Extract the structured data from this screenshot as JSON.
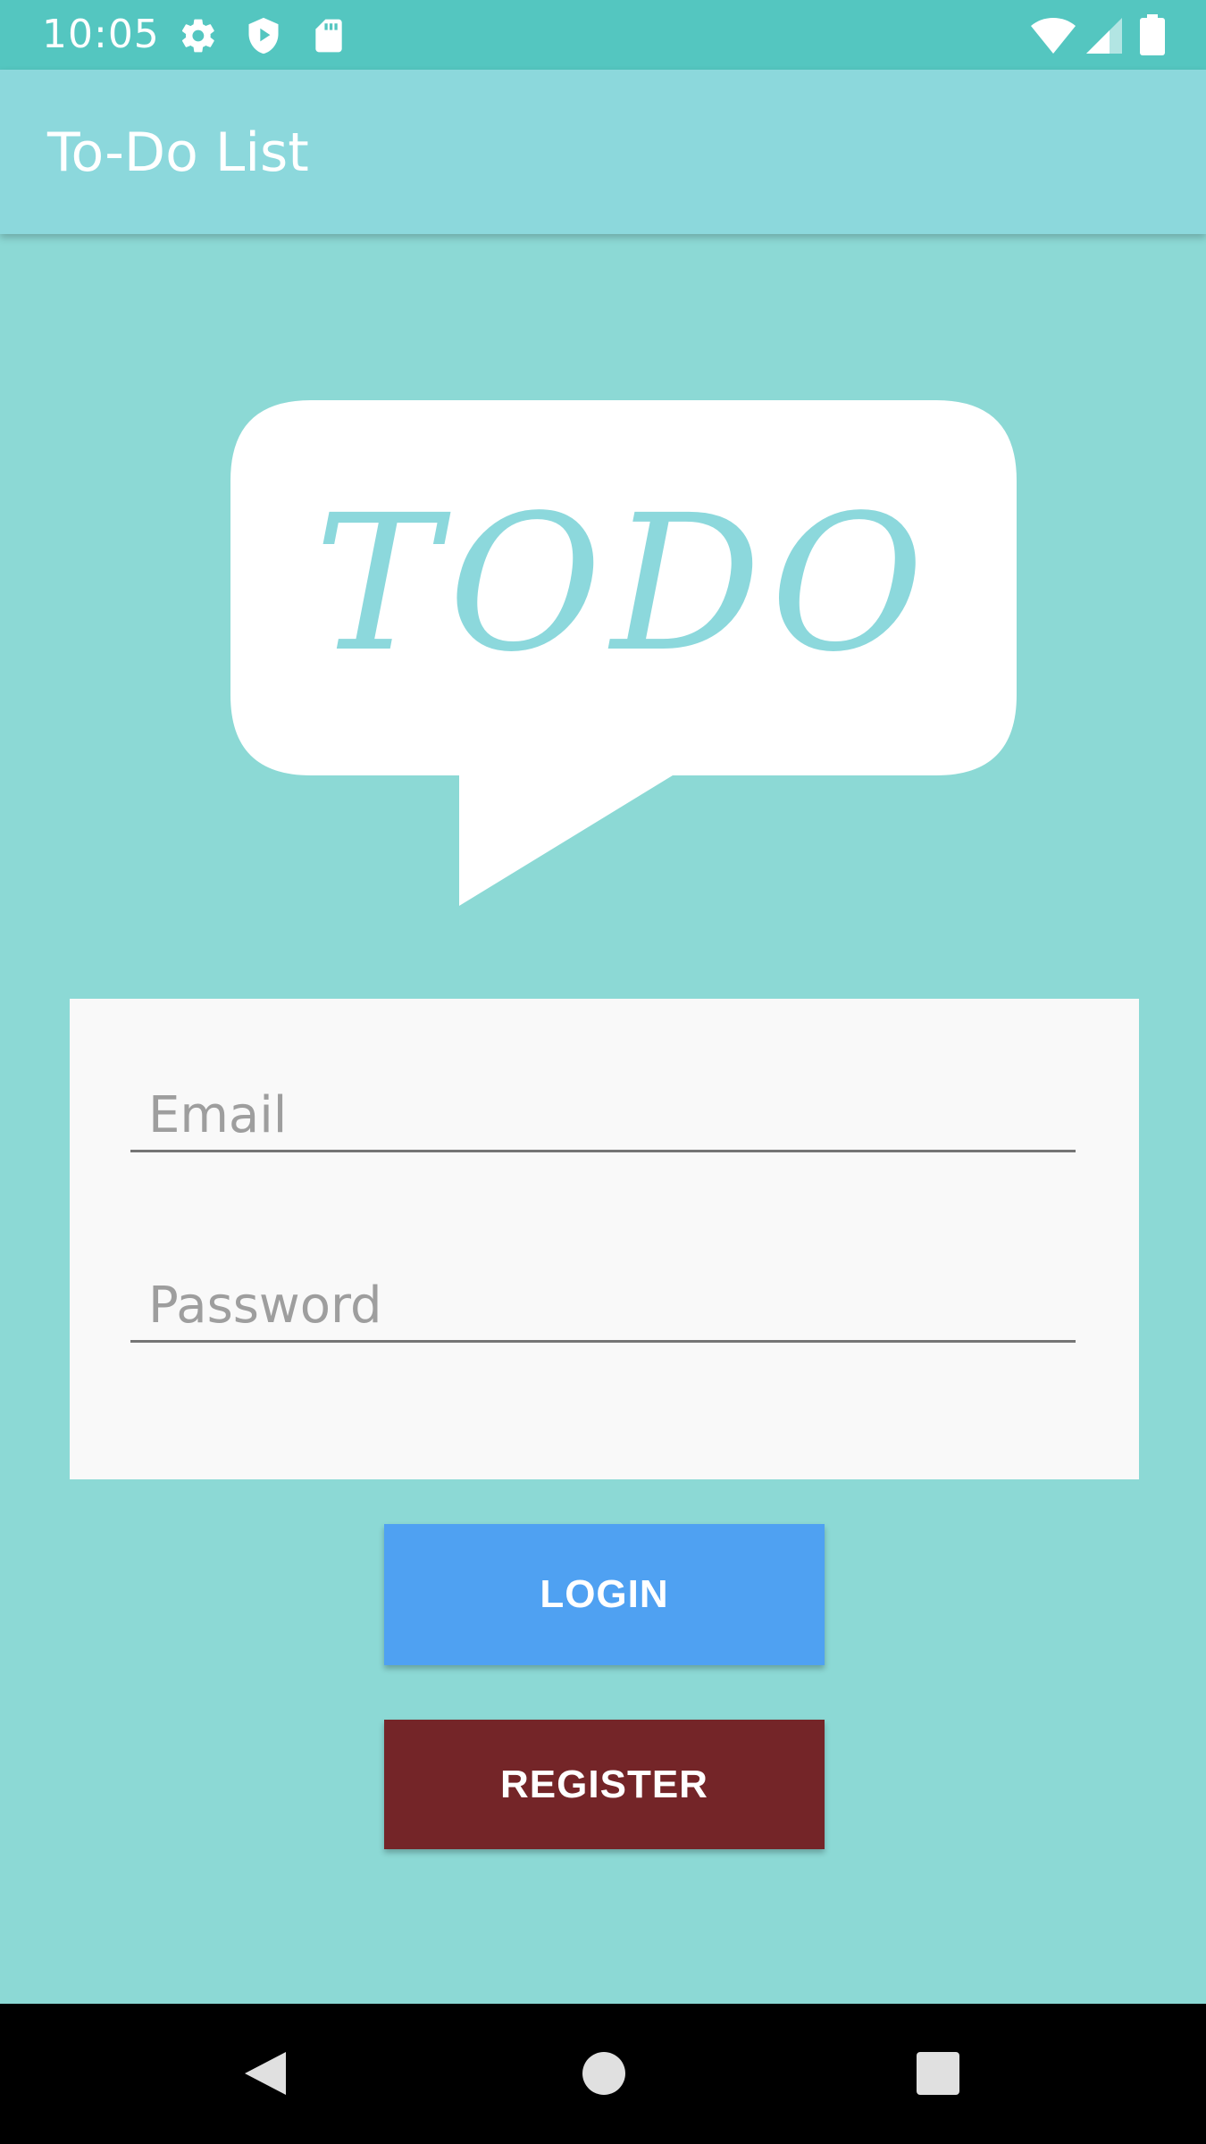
{
  "status_bar": {
    "time": "10:05",
    "left_icons": [
      "gear-icon",
      "shield-play-icon",
      "sd-card-icon"
    ],
    "right_icons": [
      "wifi-icon",
      "cell-signal-icon",
      "battery-icon"
    ],
    "color": "#54c6c0"
  },
  "app_bar": {
    "title": "To-Do List",
    "color": "#8cd8dc"
  },
  "logo": {
    "text": "TODO",
    "icon": "speech-bubble-logo",
    "text_color": "#8cd8dc"
  },
  "form": {
    "email_placeholder": "Email",
    "email_value": "",
    "password_placeholder": "Password",
    "password_value": ""
  },
  "buttons": {
    "login_label": "LOGIN",
    "login_color": "#4fa1f2",
    "register_label": "REGISTER",
    "register_color": "#742528"
  },
  "nav_bar": {
    "icons": [
      "back-triangle-icon",
      "home-circle-icon",
      "recents-square-icon"
    ]
  },
  "colors": {
    "background": "#8cd9d5"
  }
}
